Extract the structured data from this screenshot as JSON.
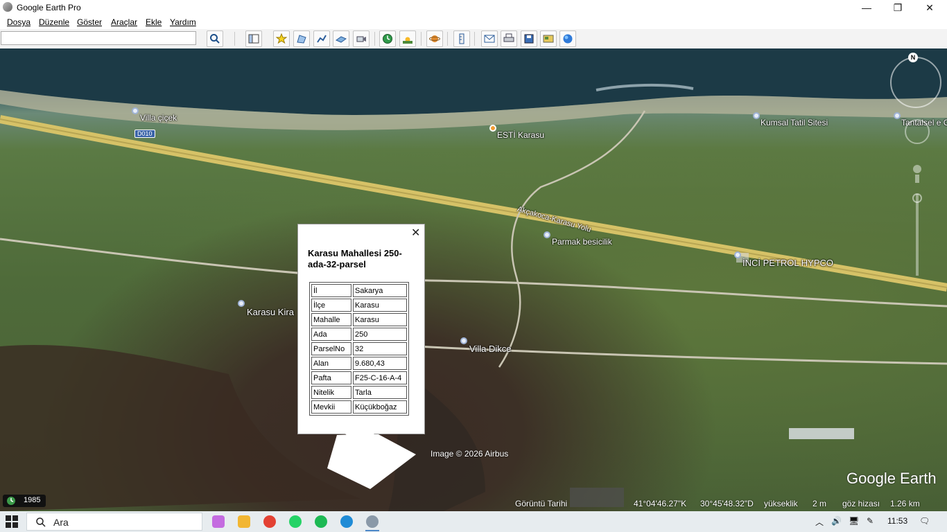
{
  "window": {
    "title": "Google Earth Pro",
    "minimize_label": "—",
    "restore_label": "❐",
    "close_label": "✕"
  },
  "menu": [
    "Dosya",
    "Düzenle",
    "Göster",
    "Araçlar",
    "Ekle",
    "Yardım"
  ],
  "search": {
    "value": "",
    "placeholder": ""
  },
  "toolbar": [
    "search-icon",
    "sidebar-toggle-icon",
    "add-placemark-icon",
    "add-polygon-icon",
    "add-path-icon",
    "add-image-overlay-icon",
    "record-tour-icon",
    "historical-imagery-icon",
    "sunlight-icon",
    "switch-planet-icon",
    "ruler-icon",
    "email-icon",
    "print-icon",
    "save-image-icon",
    "view-in-maps-icon",
    "earth-icon"
  ],
  "map": {
    "places": {
      "villa_cicek": "Villa çiçek",
      "esti_karasu": "ESTİ Karasu",
      "kumsal": "Kumsal Tatil Sitesi",
      "tantalsel": "Tantalsel e C",
      "road": "Akçakoca-Karasu Yolu",
      "parmak": "Parmak besicilik",
      "inci_petrol": "İNCİ PETROL HYPCO",
      "karasu_kira": "Karasu Kira",
      "villa_dikce": "Villa Dikce"
    },
    "road_badge": "D010",
    "compass_north": "N",
    "attribution": "Image © 2026 Airbus",
    "logo": "Google Earth"
  },
  "popup": {
    "close_label": "✕",
    "title": "Karasu Mahallesi 250-ada-32-parsel",
    "rows": [
      {
        "key": "İl",
        "value": "Sakarya"
      },
      {
        "key": "İlçe",
        "value": "Karasu"
      },
      {
        "key": "Mahalle",
        "value": "Karasu"
      },
      {
        "key": "Ada",
        "value": "250"
      },
      {
        "key": "ParselNo",
        "value": "32"
      },
      {
        "key": "Alan",
        "value": "9.680,43"
      },
      {
        "key": "Pafta",
        "value": "F25-C-16-A-4"
      },
      {
        "key": "Nitelik",
        "value": "Tarla"
      },
      {
        "key": "Mevkii",
        "value": "Küçükboğaz"
      }
    ]
  },
  "status": {
    "year": "1985",
    "imagery_date_label": "Görüntü Tarihi",
    "lat": "41°04'46.27\"K",
    "lon": "30°45'48.32\"D",
    "elevation_label": "yükseklik",
    "elevation": "2 m",
    "eye_alt_label": "göz hizası",
    "eye_alt": "1.26 km"
  },
  "taskbar": {
    "search_label": "Ara",
    "time": "11:53",
    "colors": {
      "copilot": "#c46be0",
      "explorer": "#f2b632",
      "chrome": "#e34133",
      "whatsapp": "#25d366",
      "spotify": "#1db954",
      "edge": "#1f8bd6",
      "earth": "#8a99a8"
    }
  }
}
